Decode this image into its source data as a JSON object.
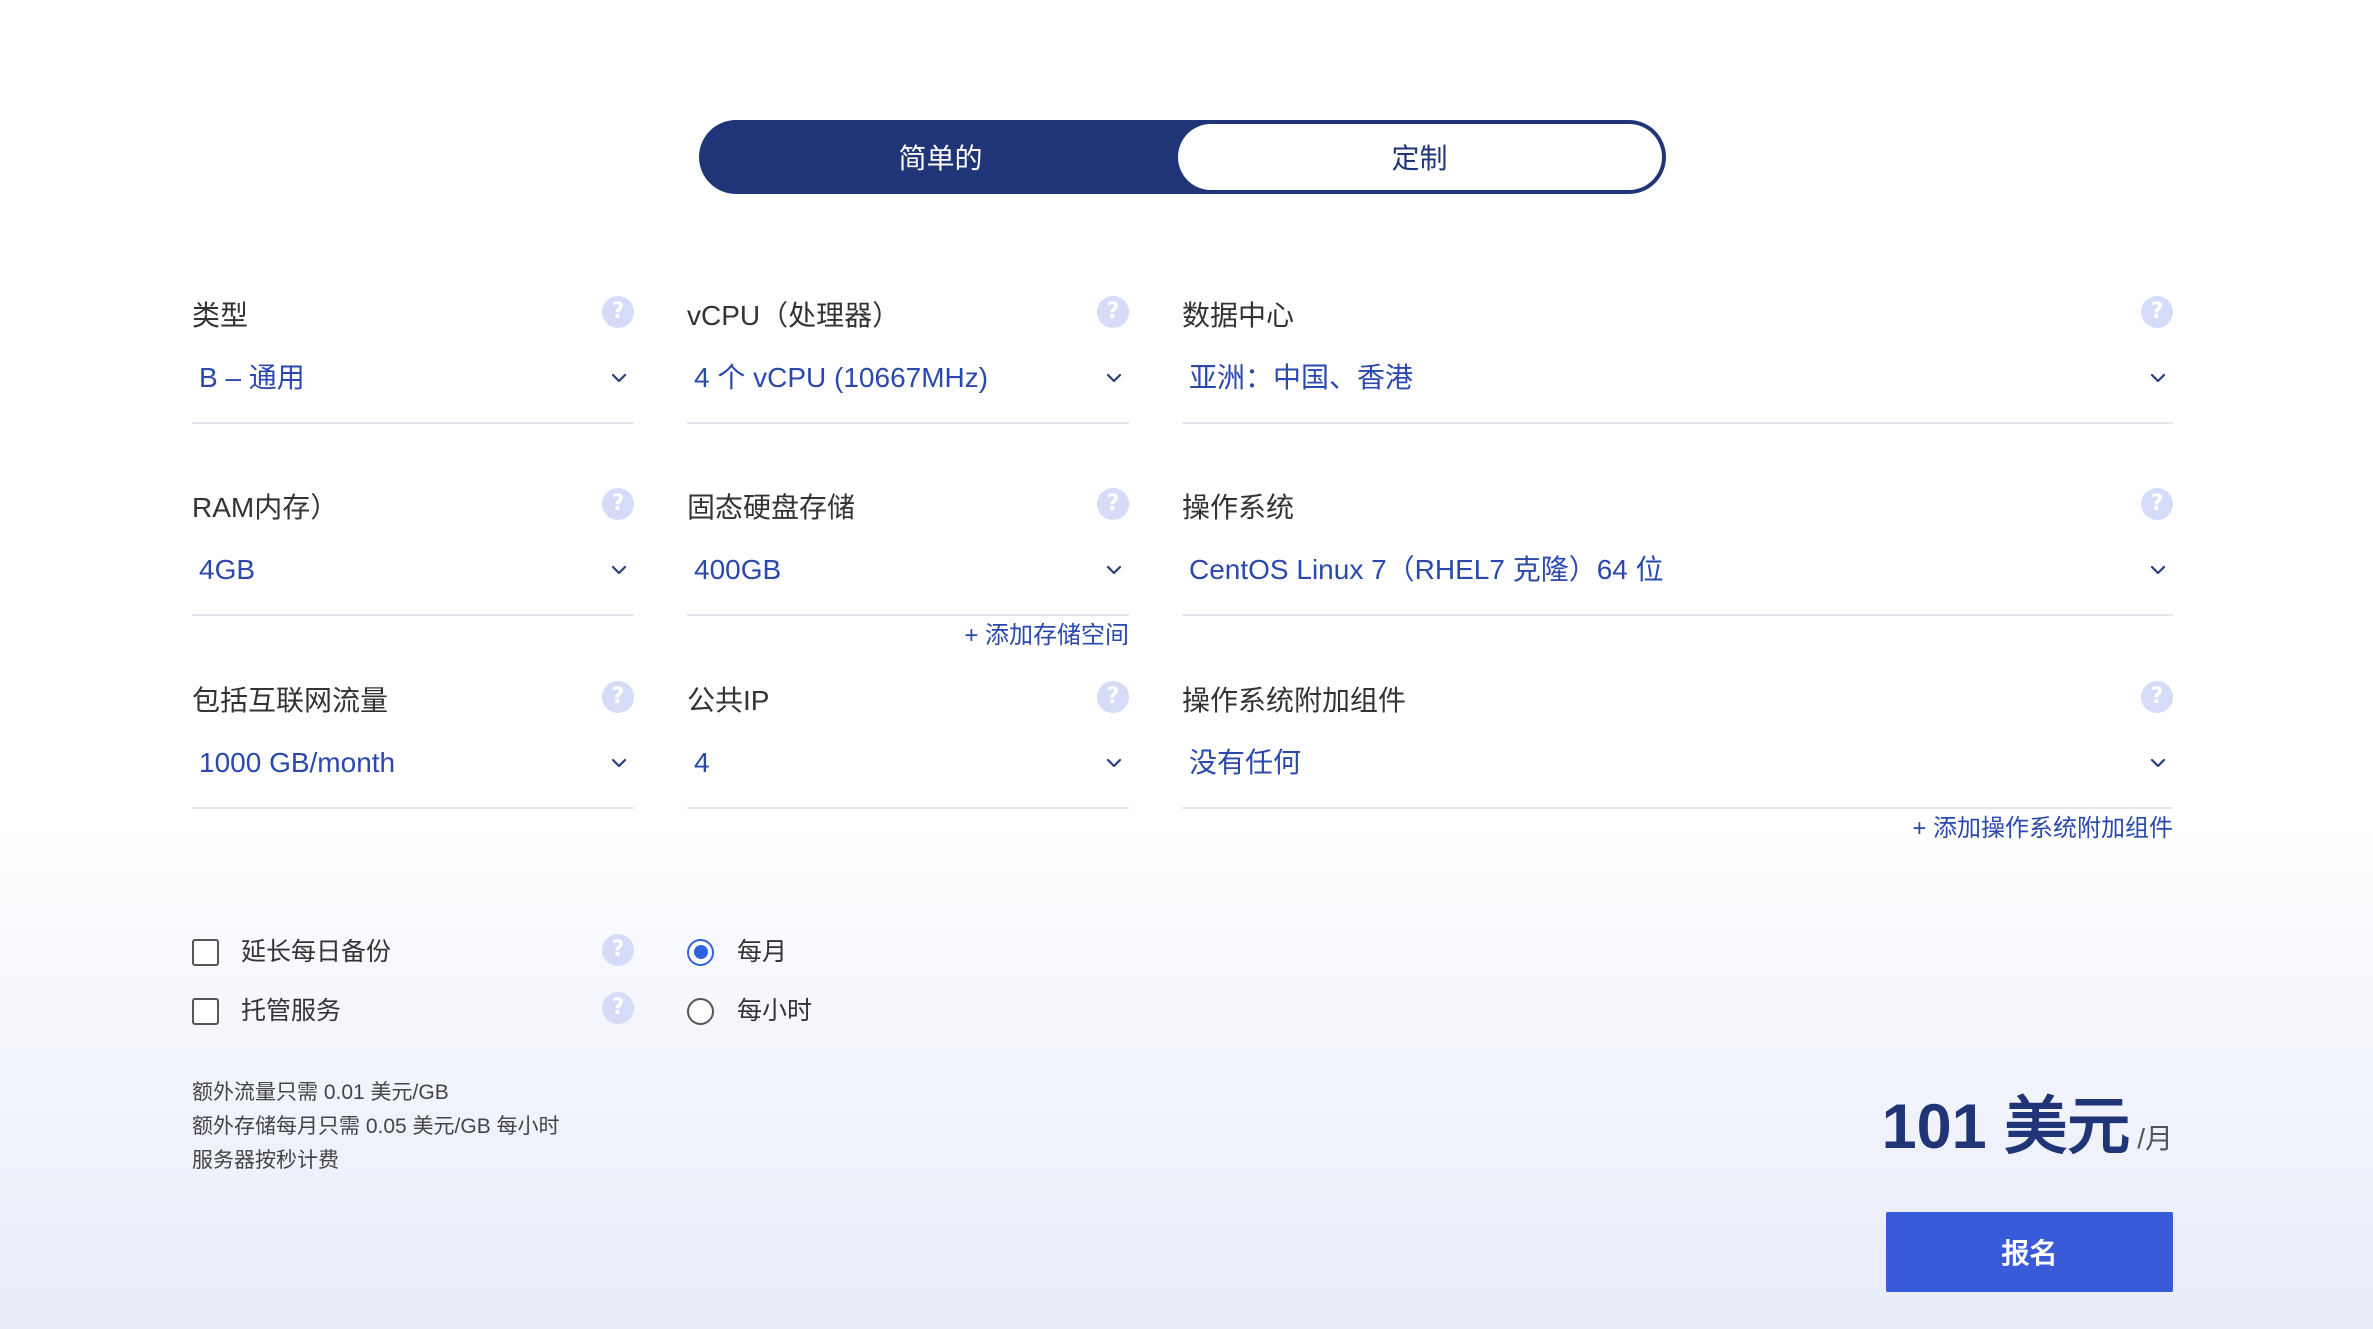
{
  "plan_toggle": {
    "options": [
      {
        "label": "简单的",
        "active": true
      },
      {
        "label": "定制",
        "active": false
      }
    ]
  },
  "config": {
    "type": {
      "label": "类型",
      "value": "B – 通用"
    },
    "vcpu": {
      "label": "vCPU（处理器）",
      "value": "4 个 vCPU (10667MHz)"
    },
    "datacenter": {
      "label": "数据中心",
      "value": "亚洲：中国、香港"
    },
    "ram": {
      "label": "RAM内存）",
      "value": "4GB"
    },
    "ssd_storage": {
      "label": "固态硬盘存储",
      "value": "400GB",
      "add_link": "+ 添加存储空间"
    },
    "os": {
      "label": "操作系统",
      "value": "CentOS Linux 7（RHEL7 克隆）64 位"
    },
    "traffic": {
      "label": "包括互联网流量",
      "value": "1000 GB/month"
    },
    "public_ip": {
      "label": "公共IP",
      "value": "4"
    },
    "os_addons": {
      "label": "操作系统附加组件",
      "value": "没有任何",
      "add_link": "+ 添加操作系统附加组件"
    }
  },
  "extras": [
    {
      "label": "延长每日备份",
      "checked": false
    },
    {
      "label": "托管服务",
      "checked": false
    }
  ],
  "billing": {
    "options": [
      {
        "label": "每月",
        "selected": true
      },
      {
        "label": "每小时",
        "selected": false
      }
    ]
  },
  "notes": [
    "额外流量只需 0.01 美元/GB",
    "额外存储每月只需 0.05 美元/GB 每小时",
    "服务器按秒计费"
  ],
  "price": {
    "amount": "101 美元",
    "period": "/月"
  },
  "signup_button": {
    "label": "报名"
  },
  "icons": {
    "help": "question-mark-icon",
    "dropdown": "chevron-down-icon",
    "checkbox": "checkbox-icon",
    "radio": "radio-button-icon"
  },
  "colors": {
    "navy": "#1f3577",
    "value_blue": "#2a48ad",
    "button_blue": "#3a5bd9",
    "radio_blue": "#2f62e0",
    "help_icon": "#d5dcf7"
  }
}
